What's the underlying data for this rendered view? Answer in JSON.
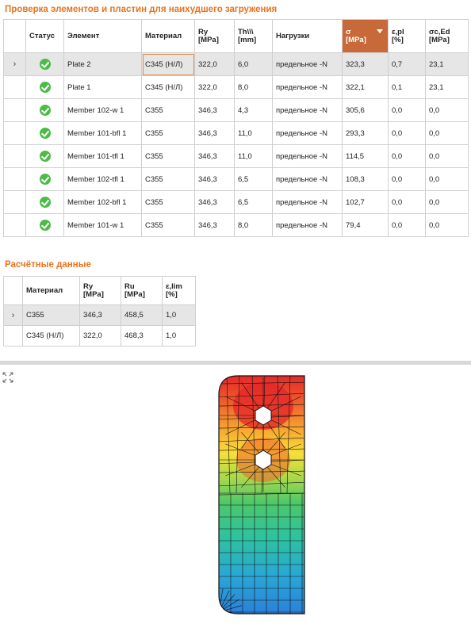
{
  "worst_check": {
    "title": "Проверка элементов и пластин для наихудшего загружения",
    "headers": {
      "status": "Статус",
      "element": "Элемент",
      "material": "Материал",
      "ry": "Ry",
      "ry_unit": "[MPa]",
      "th": "Th\\\\\\",
      "th_unit": "[mm]",
      "loads": "Нагрузки",
      "sigma": "σ",
      "sigma_unit": "[MPa]",
      "epl": "ε,pl",
      "epl_unit": "[%]",
      "sced": "σc,Ed",
      "sced_unit": "[MPa]"
    },
    "rows": [
      {
        "status": "ok",
        "element": "Plate 2",
        "material": "C345 (Н/Л)",
        "ry": "322,0",
        "th": "6,0",
        "loads": "предельное -N",
        "sigma": "323,3",
        "epl": "0,7",
        "sced": "23,1"
      },
      {
        "status": "ok",
        "element": "Plate 1",
        "material": "C345 (Н/Л)",
        "ry": "322,0",
        "th": "8,0",
        "loads": "предельное -N",
        "sigma": "322,1",
        "epl": "0,1",
        "sced": "23,1"
      },
      {
        "status": "ok",
        "element": "Member 102-w 1",
        "material": "C355",
        "ry": "346,3",
        "th": "4,3",
        "loads": "предельное -N",
        "sigma": "305,6",
        "epl": "0,0",
        "sced": "0,0"
      },
      {
        "status": "ok",
        "element": "Member 101-bfl 1",
        "material": "C355",
        "ry": "346,3",
        "th": "11,0",
        "loads": "предельное -N",
        "sigma": "293,3",
        "epl": "0,0",
        "sced": "0,0"
      },
      {
        "status": "ok",
        "element": "Member 101-tfl 1",
        "material": "C355",
        "ry": "346,3",
        "th": "11,0",
        "loads": "предельное -N",
        "sigma": "114,5",
        "epl": "0,0",
        "sced": "0,0"
      },
      {
        "status": "ok",
        "element": "Member 102-tfl 1",
        "material": "C355",
        "ry": "346,3",
        "th": "6,5",
        "loads": "предельное -N",
        "sigma": "108,3",
        "epl": "0,0",
        "sced": "0,0"
      },
      {
        "status": "ok",
        "element": "Member 102-bfl 1",
        "material": "C355",
        "ry": "346,3",
        "th": "6,5",
        "loads": "предельное -N",
        "sigma": "102,7",
        "epl": "0,0",
        "sced": "0,0"
      },
      {
        "status": "ok",
        "element": "Member 101-w 1",
        "material": "C355",
        "ry": "346,3",
        "th": "8,0",
        "loads": "предельное -N",
        "sigma": "79,4",
        "epl": "0,0",
        "sced": "0,0"
      }
    ]
  },
  "design_data": {
    "title": "Расчётные данные",
    "headers": {
      "material": "Материал",
      "ry": "Ry",
      "ry_unit": "[MPa]",
      "ru": "Ru",
      "ru_unit": "[MPa]",
      "elim": "ε,lim",
      "elim_unit": "[%]"
    },
    "rows": [
      {
        "material": "C355",
        "ry": "346,3",
        "ru": "458,5",
        "elim": "1,0"
      },
      {
        "material": "C345 (Н/Л)",
        "ry": "322,0",
        "ru": "468,3",
        "elim": "1,0"
      }
    ]
  },
  "row_indicator": "›",
  "colors": {
    "accent": "#e8731e",
    "sorted_header": "#c8693a",
    "status_ok": "#4cbb47",
    "selected_row": "#e6e6e6"
  },
  "icons": {
    "status": "check-circle-icon",
    "expand": "expand-arrows-icon",
    "sort": "sort-descending-icon"
  }
}
